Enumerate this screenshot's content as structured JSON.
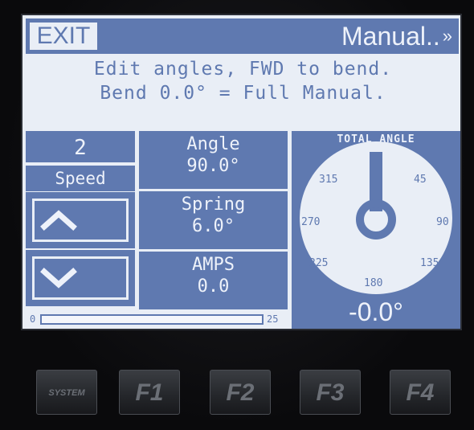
{
  "header": {
    "exit_label": "EXIT",
    "mode_label": "Manual..",
    "mode_chevron": "»"
  },
  "instructions": {
    "line1": "Edit angles, FWD to bend.",
    "line2": "Bend 0.0° = Full Manual."
  },
  "speed": {
    "value": "2",
    "label": "Speed",
    "up_icon": "chevron-up-icon",
    "up_glyph": "^",
    "down_icon": "chevron-down-icon",
    "down_glyph": "v"
  },
  "angle": {
    "label": "Angle",
    "value": "90.0°"
  },
  "spring": {
    "label": "Spring",
    "value": "6.0°"
  },
  "amps": {
    "label": "AMPS",
    "value": "0.0"
  },
  "progress": {
    "min": "0",
    "max": "25",
    "value": 0
  },
  "gauge": {
    "title": "TOTAL ANGLE",
    "ticks": [
      "315",
      "45",
      "270",
      "90",
      "225",
      "135",
      "180"
    ],
    "needle_angle_deg": 0,
    "readout": "-0.0°"
  },
  "softkeys": [
    "SYSTEM",
    "F1",
    "F2",
    "F3",
    "F4"
  ],
  "colors": {
    "accent": "#5f79b0",
    "screen": "#e9eef6",
    "text_light": "#eef2fa"
  }
}
